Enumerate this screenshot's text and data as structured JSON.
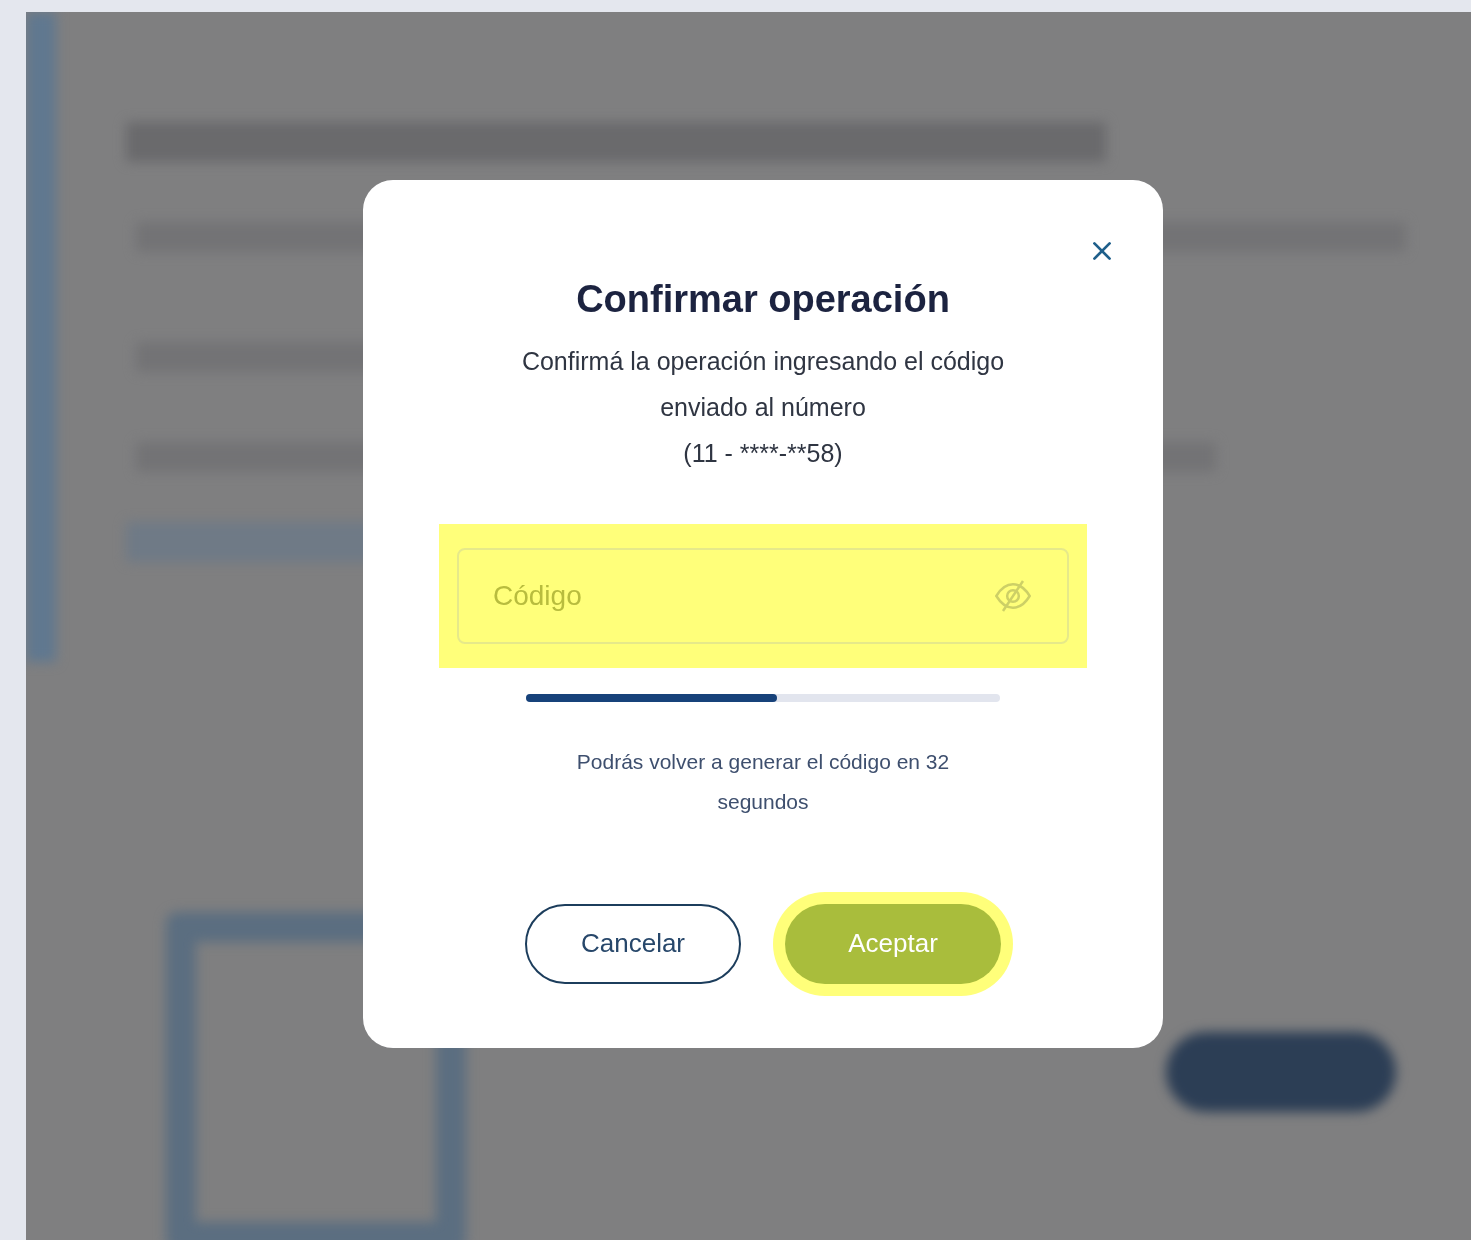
{
  "dialog": {
    "title": "Confirmar operación",
    "message": "Confirmá la operación ingresando el código enviado al número",
    "phone": "(11 - ****-**58)"
  },
  "code_field": {
    "placeholder": "Código",
    "highlighted": true
  },
  "timer": {
    "level": 0.53,
    "text": "Podrás volver a generar el código en 32 segundos"
  },
  "buttons": [
    {
      "label": "Cancelar",
      "kind": "outline",
      "disabled": false,
      "highlighted": false
    },
    {
      "label": "Aceptar",
      "kind": "primary",
      "disabled": true,
      "highlighted": true
    }
  ]
}
